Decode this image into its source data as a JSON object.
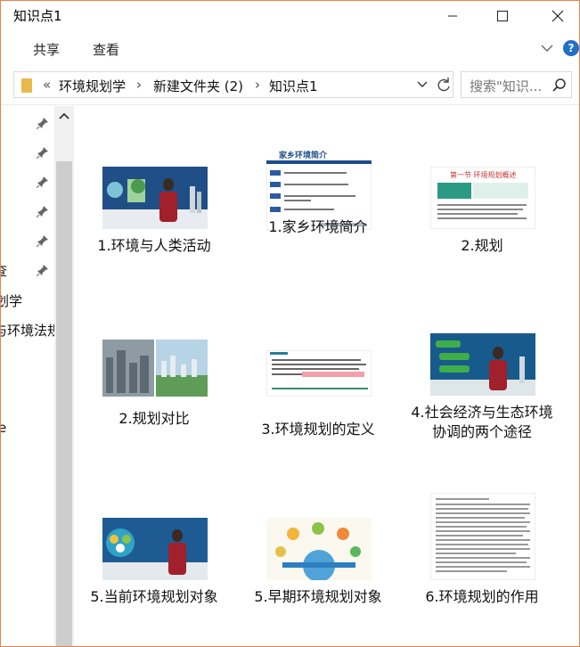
{
  "window": {
    "title": "知识点1",
    "minimize_icon": "minimize-icon",
    "maximize_icon": "maximize-icon",
    "close_icon": "close-icon"
  },
  "ribbon": {
    "tabs": [
      {
        "label": "共享"
      },
      {
        "label": "查看"
      }
    ]
  },
  "address": {
    "overflow": "«",
    "crumbs": [
      {
        "label": "环境规划学"
      },
      {
        "label": "新建文件夹 (2)"
      },
      {
        "label": "知识点1"
      }
    ],
    "separator": "›"
  },
  "search": {
    "placeholder": "搜索\"知识..."
  },
  "nav": {
    "items": [
      {
        "label": "查"
      },
      {
        "label": "划学"
      },
      {
        "label": "与环境法规"
      },
      {
        "label": "e"
      }
    ]
  },
  "files": [
    {
      "name": "1.环境与人类活动"
    },
    {
      "name": "1.家乡环境简介"
    },
    {
      "name": "2.规划"
    },
    {
      "name": "2.规划对比"
    },
    {
      "name": "3.环境规划的定义"
    },
    {
      "name": "4.社会经济与生态环境协调的两个途径"
    },
    {
      "name": "5.当前环境规划对象"
    },
    {
      "name": "5.早期环境规划对象"
    },
    {
      "name": "6.环境规划的作用"
    }
  ],
  "thumb_text": {
    "t2_header": "家乡环境简介",
    "t3_header": "第一节  环境规划概述"
  }
}
